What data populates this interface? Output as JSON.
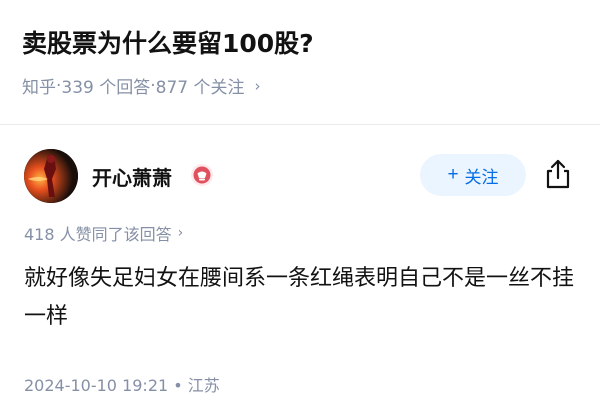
{
  "question": {
    "title": "卖股票为什么要留100股?",
    "source": "知乎",
    "answers": "339 个回答",
    "followers": "877 个关注",
    "sep": " · "
  },
  "author": {
    "name": "开心萧萧",
    "follow_label": "关注",
    "follow_plus": "+"
  },
  "answer": {
    "likes": "418 人赞同了该回答",
    "text": "就好像失足妇女在腰间系一条红绳表明自己不是一丝不挂一样",
    "date": "2024-10-10 19:21",
    "location": "江苏",
    "footer_sep": " • "
  },
  "icons": {
    "chevron": "chevron-right-icon",
    "share": "share-icon",
    "badge": "badge-icon"
  },
  "colors": {
    "accent": "#056de8",
    "follow_bg": "#ebf5ff",
    "meta": "#8590a6",
    "badge": "#e0515f"
  }
}
